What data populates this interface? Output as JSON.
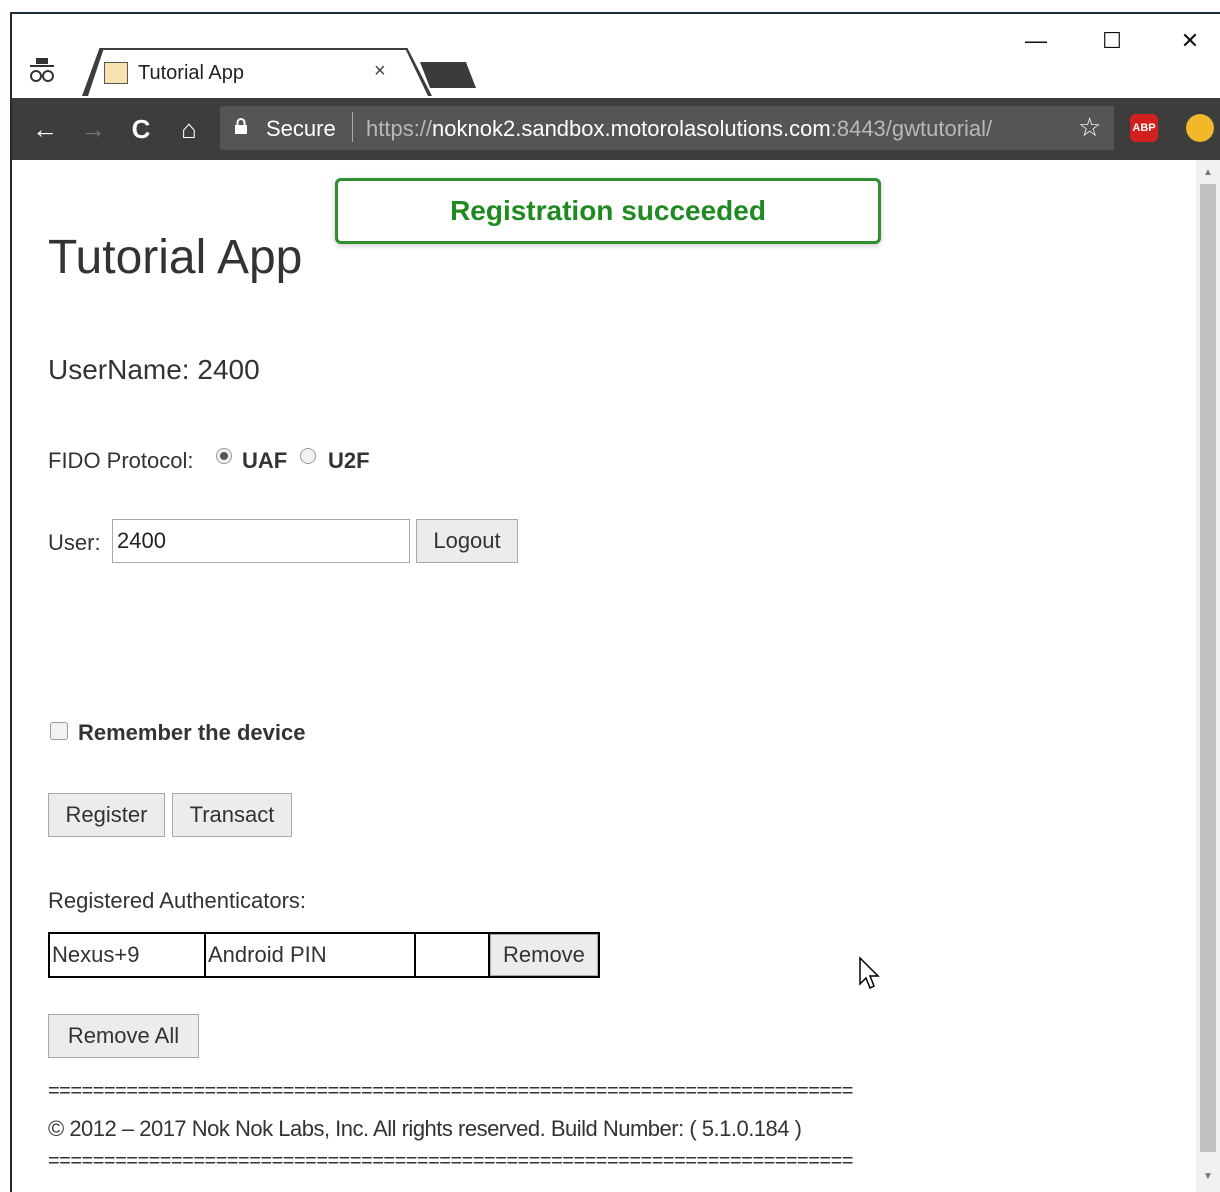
{
  "browser": {
    "tab_title": "Tutorial App",
    "tab_close": "×",
    "window_controls": {
      "minimize": "—",
      "maximize": "☐",
      "close": "✕"
    },
    "nav": {
      "back": "←",
      "forward": "→",
      "reload": "C",
      "home": "⌂"
    },
    "secure_label": "Secure",
    "url_scheme": "https://",
    "url_host": "noknok2.sandbox.motorolasolutions.com",
    "url_rest": ":8443/gwtutorial/",
    "star_icon": "☆",
    "abp_label": "ABP",
    "icons": [
      "incognito-icon",
      "tab-favicon-icon",
      "lock-icon",
      "bookmark-star-icon",
      "adblock-plus-icon",
      "extension-icon",
      "cursor-icon"
    ]
  },
  "toast": {
    "message": "Registration succeeded",
    "border_color": "#2f8f2f",
    "text_color": "#1f8a1f"
  },
  "page": {
    "title": "Tutorial App",
    "username_line": "UserName: 2400",
    "fido_label": "FIDO Protocol:",
    "protocol_options": [
      {
        "label": "UAF",
        "selected": true
      },
      {
        "label": "U2F",
        "selected": false
      }
    ],
    "user_label": "User:",
    "user_value": "2400",
    "logout_label": "Logout",
    "remember_label": "Remember the device",
    "remember_checked": false,
    "register_label": "Register",
    "transact_label": "Transact",
    "registered_label": "Registered Authenticators:",
    "authenticators": [
      {
        "device": "Nexus+9",
        "type": "Android PIN",
        "extra": "",
        "remove_label": "Remove"
      }
    ],
    "remove_all_label": "Remove All",
    "separator": "========================================================================",
    "copyright": "© 2012 – 2017 Nok Nok Labs, Inc. All rights reserved. Build Number: ( 5.1.0.184 )"
  }
}
